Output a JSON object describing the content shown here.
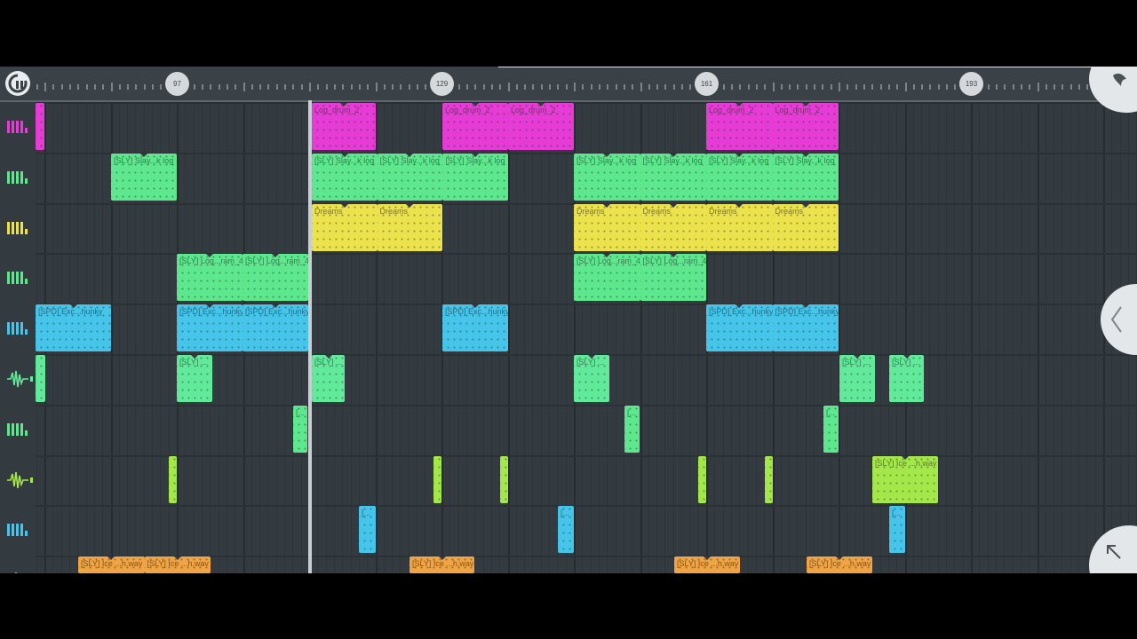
{
  "ruler": {
    "markers": [
      {
        "label": "97"
      },
      {
        "label": "129"
      },
      {
        "label": "161"
      },
      {
        "label": "193"
      }
    ]
  },
  "tracks": [
    {
      "icon": "piano-keys-icon",
      "color": "#e63bd5"
    },
    {
      "icon": "piano-keys-icon",
      "color": "#5de88e"
    },
    {
      "icon": "piano-keys-icon",
      "color": "#ece24b"
    },
    {
      "icon": "piano-keys-icon",
      "color": "#5de88e"
    },
    {
      "icon": "piano-keys-icon",
      "color": "#45c5ea"
    },
    {
      "icon": "waveform-icon",
      "color": "#62ea9b"
    },
    {
      "icon": "piano-keys-icon",
      "color": "#5de88e"
    },
    {
      "icon": "waveform-icon",
      "color": "#a3e848"
    },
    {
      "icon": "piano-keys-icon",
      "color": "#45c5ea"
    },
    {
      "icon": "waveform-icon",
      "color": "#f1a444"
    }
  ],
  "clips": {
    "log_drum": "Log_drum_2",
    "slay_log": "[SLY] Slay...k log",
    "dreams": "Dreams",
    "log_ram": "[SLY] Log...ram_4",
    "spd_chunky": "[SPD] Exc...hunky",
    "sly_short": "[SLY] ...",
    "bracket": "[...",
    "sly_ice_wav": "[SLY] Ice ...h.wav"
  },
  "controls": {
    "logo_icon": "fl-studio-logo-icon",
    "collapse_icon": "chevron-left-icon",
    "fullscreen_icon": "arrow-up-left-icon"
  }
}
